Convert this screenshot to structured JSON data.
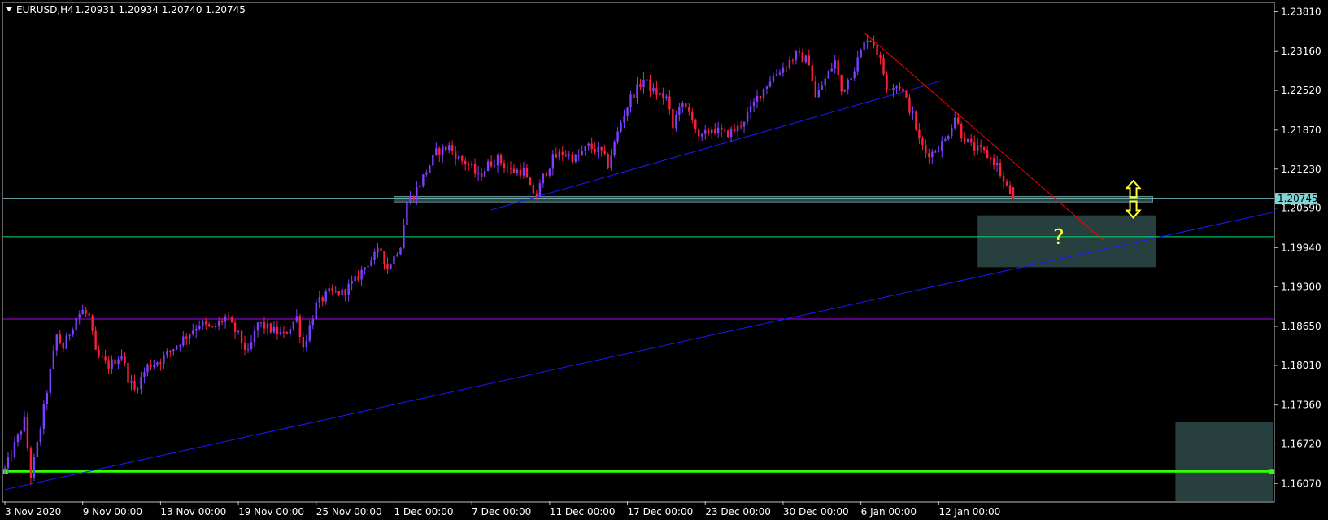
{
  "header": {
    "symbol_label": "EURUSD,H4",
    "ohlc_text": "1.20931 1.20934 1.20740 1.20745"
  },
  "colors": {
    "background": "#000000",
    "frame": "#c0c0c0",
    "bull": "#7b3fff",
    "bear": "#ff1f3a",
    "trend_blue": "#1a1aff",
    "trend_red": "#ff0000",
    "level_cyan": "#7fcfcf",
    "level_green": "#00e070",
    "level_magenta": "#b000ff",
    "support_band": "#33ff00",
    "zone_fill": "#2f4a4a",
    "price_tag": "#7fd4d4",
    "arrow_yellow": "#ffff33"
  },
  "icons": {
    "menu_triangle": "down-triangle-icon",
    "arrow_up": "hollow-up-arrow-icon",
    "arrow_down": "hollow-down-arrow-icon"
  },
  "chart_data": {
    "type": "candlestick",
    "title": "EURUSD,H4",
    "symbol": "EURUSD",
    "timeframe": "H4",
    "ohlc_last": {
      "open": 1.20931,
      "high": 1.20934,
      "low": 1.2074,
      "close": 1.20745
    },
    "current_price_label": "1.20745",
    "current_price": 1.20745,
    "ylim": [
      1.1578,
      1.2395
    ],
    "y_ticks": [
      {
        "value": 1.2381,
        "label": "1.23810"
      },
      {
        "value": 1.2316,
        "label": "1.23160"
      },
      {
        "value": 1.2252,
        "label": "1.22520"
      },
      {
        "value": 1.2187,
        "label": "1.21870"
      },
      {
        "value": 1.2123,
        "label": "1.21230"
      },
      {
        "value": 1.2059,
        "label": "1.20590"
      },
      {
        "value": 1.1994,
        "label": "1.19940"
      },
      {
        "value": 1.193,
        "label": "1.19300"
      },
      {
        "value": 1.1865,
        "label": "1.18650"
      },
      {
        "value": 1.1801,
        "label": "1.18010"
      },
      {
        "value": 1.1736,
        "label": "1.17360"
      },
      {
        "value": 1.1672,
        "label": "1.16720"
      },
      {
        "value": 1.1607,
        "label": "1.16070"
      }
    ],
    "x_ticks": [
      {
        "bar": 0,
        "label": "3 Nov 2020"
      },
      {
        "bar": 24,
        "label": "9 Nov 00:00"
      },
      {
        "bar": 48,
        "label": "13 Nov 00:00"
      },
      {
        "bar": 72,
        "label": "19 Nov 00:00"
      },
      {
        "bar": 96,
        "label": "25 Nov 00:00"
      },
      {
        "bar": 120,
        "label": "1 Dec 00:00"
      },
      {
        "bar": 144,
        "label": "7 Dec 00:00"
      },
      {
        "bar": 168,
        "label": "11 Dec 00:00"
      },
      {
        "bar": 192,
        "label": "17 Dec 00:00"
      },
      {
        "bar": 216,
        "label": "23 Dec 00:00"
      },
      {
        "bar": 240,
        "label": "30 Dec 00:00"
      },
      {
        "bar": 264,
        "label": "6 Jan 00:00"
      },
      {
        "bar": 288,
        "label": "12 Jan 00:00"
      }
    ],
    "last_bar": 311,
    "bar_count_visible": 392,
    "close_path": [
      [
        0,
        1.163
      ],
      [
        3,
        1.167
      ],
      [
        6,
        1.171
      ],
      [
        8,
        1.162
      ],
      [
        10,
        1.167
      ],
      [
        14,
        1.179
      ],
      [
        16,
        1.185
      ],
      [
        18,
        1.183
      ],
      [
        22,
        1.188
      ],
      [
        24,
        1.189
      ],
      [
        26,
        1.188
      ],
      [
        28,
        1.182
      ],
      [
        32,
        1.18
      ],
      [
        36,
        1.182
      ],
      [
        38,
        1.178
      ],
      [
        40,
        1.176
      ],
      [
        44,
        1.18
      ],
      [
        48,
        1.181
      ],
      [
        52,
        1.183
      ],
      [
        56,
        1.185
      ],
      [
        60,
        1.187
      ],
      [
        64,
        1.186
      ],
      [
        68,
        1.188
      ],
      [
        72,
        1.185
      ],
      [
        75,
        1.182
      ],
      [
        78,
        1.187
      ],
      [
        82,
        1.186
      ],
      [
        86,
        1.185
      ],
      [
        90,
        1.188
      ],
      [
        92,
        1.183
      ],
      [
        96,
        1.19
      ],
      [
        100,
        1.192
      ],
      [
        104,
        1.192
      ],
      [
        108,
        1.194
      ],
      [
        112,
        1.197
      ],
      [
        116,
        1.199
      ],
      [
        118,
        1.196
      ],
      [
        120,
        1.198
      ],
      [
        122,
        1.2
      ],
      [
        124,
        1.207
      ],
      [
        126,
        1.208
      ],
      [
        128,
        1.21
      ],
      [
        130,
        1.212
      ],
      [
        133,
        1.215
      ],
      [
        137,
        1.216
      ],
      [
        140,
        1.214
      ],
      [
        143,
        1.213
      ],
      [
        146,
        1.211
      ],
      [
        149,
        1.213
      ],
      [
        152,
        1.214
      ],
      [
        156,
        1.212
      ],
      [
        160,
        1.212
      ],
      [
        162,
        1.209
      ],
      [
        164,
        1.208
      ],
      [
        166,
        1.211
      ],
      [
        169,
        1.214
      ],
      [
        172,
        1.215
      ],
      [
        176,
        1.214
      ],
      [
        180,
        1.216
      ],
      [
        184,
        1.215
      ],
      [
        186,
        1.213
      ],
      [
        190,
        1.22
      ],
      [
        193,
        1.224
      ],
      [
        197,
        1.227
      ],
      [
        200,
        1.225
      ],
      [
        204,
        1.224
      ],
      [
        206,
        1.219
      ],
      [
        208,
        1.223
      ],
      [
        212,
        1.221
      ],
      [
        214,
        1.217
      ],
      [
        218,
        1.219
      ],
      [
        222,
        1.218
      ],
      [
        226,
        1.219
      ],
      [
        230,
        1.222
      ],
      [
        232,
        1.224
      ],
      [
        236,
        1.227
      ],
      [
        240,
        1.229
      ],
      [
        244,
        1.231
      ],
      [
        248,
        1.23
      ],
      [
        250,
        1.224
      ],
      [
        252,
        1.226
      ],
      [
        256,
        1.23
      ],
      [
        258,
        1.225
      ],
      [
        262,
        1.229
      ],
      [
        266,
        1.234
      ],
      [
        268,
        1.233
      ],
      [
        270,
        1.23
      ],
      [
        272,
        1.226
      ],
      [
        276,
        1.226
      ],
      [
        280,
        1.221
      ],
      [
        282,
        1.217
      ],
      [
        284,
        1.215
      ],
      [
        286,
        1.215
      ],
      [
        290,
        1.217
      ],
      [
        293,
        1.221
      ],
      [
        295,
        1.218
      ],
      [
        298,
        1.216
      ],
      [
        302,
        1.215
      ],
      [
        306,
        1.213
      ],
      [
        308,
        1.21
      ],
      [
        311,
        1.20745
      ]
    ],
    "trendlines": [
      {
        "color": "red",
        "from": {
          "bar": 265,
          "price": 1.2347
        },
        "to": {
          "bar": 339,
          "price": 1.2005
        }
      },
      {
        "color": "blue",
        "from": {
          "bar": 150,
          "price": 1.2056
        },
        "to": {
          "bar": 289,
          "price": 1.2268
        }
      },
      {
        "color": "blue",
        "from": {
          "bar": 0,
          "price": 1.1597
        },
        "to": {
          "bar": 391,
          "price": 1.2052
        }
      }
    ],
    "horizontal_levels": [
      {
        "price": 1.2075,
        "color": "cyan"
      },
      {
        "price": 1.2012,
        "color": "green"
      },
      {
        "price": 1.1877,
        "color": "magenta"
      },
      {
        "price": 1.1627,
        "color": "bright-green",
        "thick": true
      }
    ],
    "zones": [
      {
        "from_bar": 120,
        "to_bar": 354,
        "top": 1.2078,
        "bottom": 1.2069
      },
      {
        "from_bar": 300,
        "to_bar": 355,
        "top": 1.2047,
        "bottom": 1.1962
      },
      {
        "from_bar": 361,
        "to_bar": 391,
        "top": 1.1708,
        "bottom": 1.1578
      }
    ],
    "annotations": [
      {
        "type": "text",
        "text": "?",
        "bar": 325,
        "price": 1.2012
      },
      {
        "type": "arrow-up",
        "bar": 348,
        "price": 1.2089
      },
      {
        "type": "arrow-down",
        "bar": 348,
        "price": 1.2058
      }
    ]
  }
}
